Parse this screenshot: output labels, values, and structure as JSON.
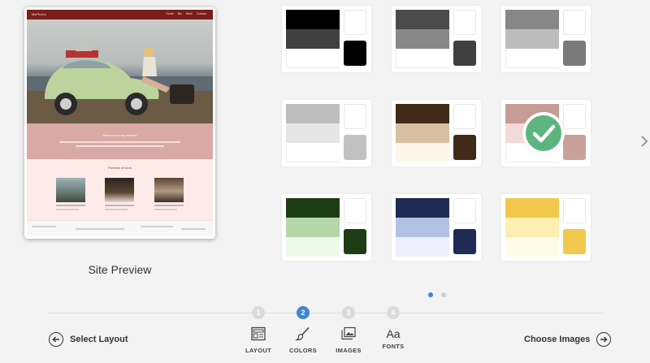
{
  "preview": {
    "label": "Site Preview",
    "nav_brand": "MyPhotos",
    "nav_links": [
      "Home",
      "Bio",
      "Work",
      "Contact"
    ],
    "hero_heading": "Welcome to my website",
    "section_heading": "Portfolio of work"
  },
  "palettes": [
    {
      "name": "black-palette",
      "bars": [
        "#000000",
        "#404040",
        "#ffffff"
      ],
      "top": "#ffffff",
      "bottom": "#000000",
      "selected": false
    },
    {
      "name": "dark-gray-palette",
      "bars": [
        "#4b4b4b",
        "#888888",
        "#ffffff"
      ],
      "top": "#ffffff",
      "bottom": "#404040",
      "selected": false
    },
    {
      "name": "gray-palette",
      "bars": [
        "#878787",
        "#bcbcbc",
        "#ffffff"
      ],
      "top": "#ffffff",
      "bottom": "#7a7a7a",
      "selected": false
    },
    {
      "name": "light-gray-palette",
      "bars": [
        "#bdbdbd",
        "#e6e6e6",
        "#ffffff"
      ],
      "top": "#ffffff",
      "bottom": "#c1c1c1",
      "selected": false
    },
    {
      "name": "brown-palette",
      "bars": [
        "#3f2b18",
        "#d7bfa0",
        "#fdf7eb"
      ],
      "top": "#ffffff",
      "bottom": "#3f2b18",
      "selected": false
    },
    {
      "name": "rose-palette",
      "bars": [
        "#c79b96",
        "#f2dad8",
        "#ffffff"
      ],
      "top": "#ffffff",
      "bottom": "#c9a09b",
      "selected": true
    },
    {
      "name": "green-palette",
      "bars": [
        "#1f3d14",
        "#b5d6a8",
        "#eefae9"
      ],
      "top": "#ffffff",
      "bottom": "#1f3d14",
      "selected": false
    },
    {
      "name": "navy-palette",
      "bars": [
        "#1f2a55",
        "#b3c2e3",
        "#edf0fb"
      ],
      "top": "#ffffff",
      "bottom": "#1f2a55",
      "selected": false
    },
    {
      "name": "yellow-palette",
      "bars": [
        "#f2c94c",
        "#fdeeb1",
        "#fffbea"
      ],
      "top": "#ffffff",
      "bottom": "#f2c94c",
      "selected": false
    }
  ],
  "pagination": {
    "current": 1,
    "total": 2
  },
  "steps": [
    {
      "number": "1",
      "label": "LAYOUT",
      "icon": "layout-icon",
      "active": false
    },
    {
      "number": "2",
      "label": "COLORS",
      "icon": "paintbrush-icon",
      "active": true
    },
    {
      "number": "3",
      "label": "IMAGES",
      "icon": "images-icon",
      "active": false
    },
    {
      "number": "4",
      "label": "FONTS",
      "icon": "fonts-icon",
      "active": false
    }
  ],
  "fonts_glyph": "Aa",
  "nav": {
    "back_label": "Select Layout",
    "next_label": "Choose Images"
  },
  "colors": {
    "accent": "#3c86d6",
    "check": "#5cb57e",
    "nav_bar": "#7a1e1a",
    "hero_pink": "#d9a9a6"
  }
}
